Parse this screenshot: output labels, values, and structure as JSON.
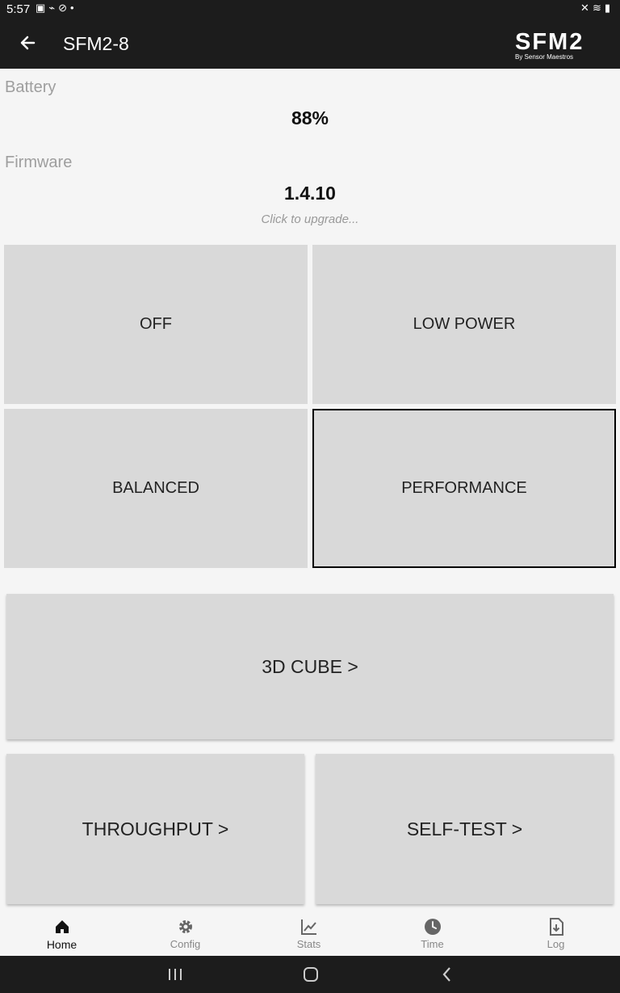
{
  "status_bar": {
    "time": "5:57",
    "left_icons": [
      "image-icon",
      "usb-icon",
      "link-icon",
      "dot-icon"
    ],
    "right_icons": [
      "mute-icon",
      "wifi-icon",
      "battery-icon"
    ]
  },
  "app_bar": {
    "title": "SFM2-8",
    "logo_main": "SFM2",
    "logo_sub": "By Sensor Maestros"
  },
  "battery": {
    "label": "Battery",
    "value": "88%"
  },
  "firmware": {
    "label": "Firmware",
    "value": "1.4.10",
    "hint": "Click to upgrade..."
  },
  "power_modes": [
    {
      "label": "OFF",
      "selected": false
    },
    {
      "label": "LOW POWER",
      "selected": false
    },
    {
      "label": "BALANCED",
      "selected": false
    },
    {
      "label": "PERFORMANCE",
      "selected": true
    }
  ],
  "actions": {
    "cube": "3D CUBE >",
    "throughput": "THROUGHPUT >",
    "selftest": "SELF-TEST >"
  },
  "bottom_nav": [
    {
      "label": "Home",
      "icon": "home-icon",
      "active": true
    },
    {
      "label": "Config",
      "icon": "gear-icon",
      "active": false
    },
    {
      "label": "Stats",
      "icon": "chart-icon",
      "active": false
    },
    {
      "label": "Time",
      "icon": "clock-icon",
      "active": false
    },
    {
      "label": "Log",
      "icon": "download-file-icon",
      "active": false
    }
  ],
  "system_nav": [
    "recents-button",
    "home-button",
    "back-button"
  ]
}
